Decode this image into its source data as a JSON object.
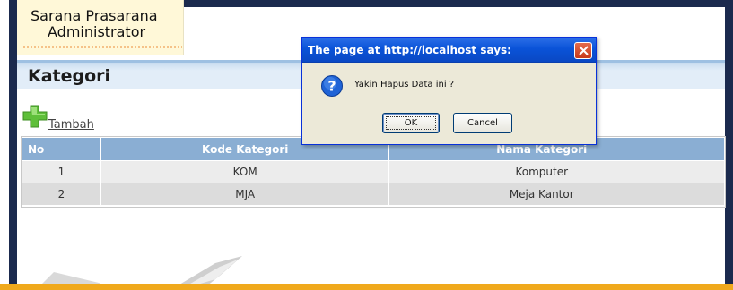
{
  "header": {
    "title_line1": "Sarana Prasarana",
    "title_line2": "Administrator"
  },
  "section": {
    "title": "Kategori",
    "add_label": "Tambah"
  },
  "table": {
    "columns": [
      "No",
      "Kode Kategori",
      "Nama Kategori",
      ""
    ],
    "rows": [
      {
        "no": "1",
        "kode": "KOM",
        "nama": "Komputer"
      },
      {
        "no": "2",
        "kode": "MJA",
        "nama": "Meja Kantor"
      }
    ]
  },
  "dialog": {
    "title": "The page at http://localhost says:",
    "message": "Yakin Hapus Data ini ?",
    "ok_label": "OK",
    "cancel_label": "Cancel",
    "icon": "question-icon"
  },
  "colors": {
    "frame": "#1b2a4e",
    "title_card": "#fff8d8",
    "table_header": "#8aaed3",
    "accent_bottom": "#f0a91c",
    "dialog_title": "#0a53d8"
  }
}
